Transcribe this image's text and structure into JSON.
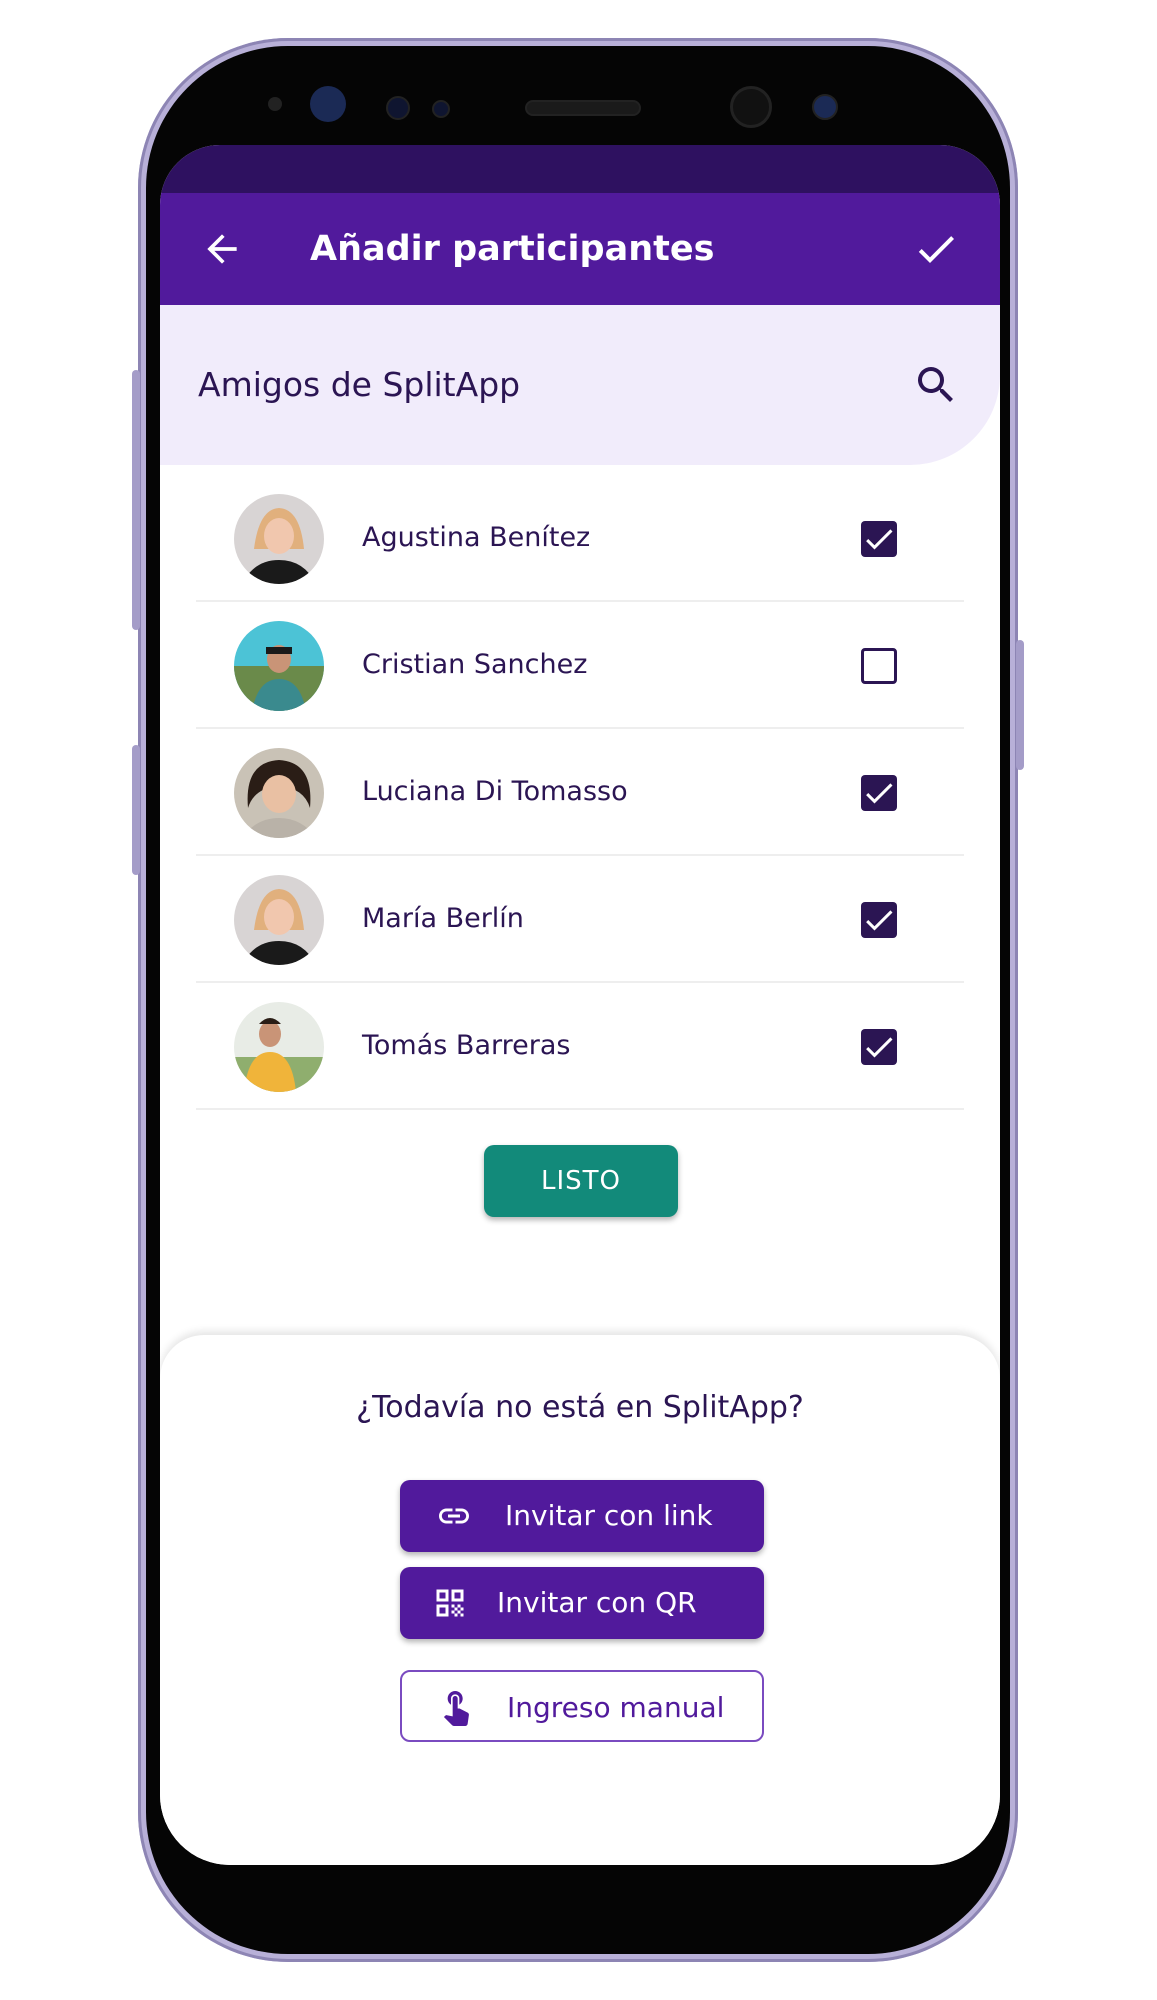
{
  "app_bar": {
    "title": "Añadir participantes",
    "back_icon": "arrow-left-icon",
    "confirm_icon": "check-icon"
  },
  "section": {
    "title": "Amigos de SplitApp",
    "search_icon": "search-icon"
  },
  "friends": [
    {
      "name": "Agustina Benítez",
      "checked": true
    },
    {
      "name": "Cristian Sanchez",
      "checked": false
    },
    {
      "name": "Luciana Di Tomasso",
      "checked": true
    },
    {
      "name": "María Berlín",
      "checked": true
    },
    {
      "name": "Tomás Barreras",
      "checked": true
    }
  ],
  "done_button": "LISTO",
  "invite": {
    "question": "¿Todavía no está en SplitApp?",
    "link_button": "Invitar con link",
    "qr_button": "Invitar con QR",
    "manual_button": "Ingreso manual"
  },
  "colors": {
    "primary": "#511a9c",
    "text": "#2b1553",
    "accent": "#128a7a",
    "header_bg": "#f1ecfb"
  }
}
